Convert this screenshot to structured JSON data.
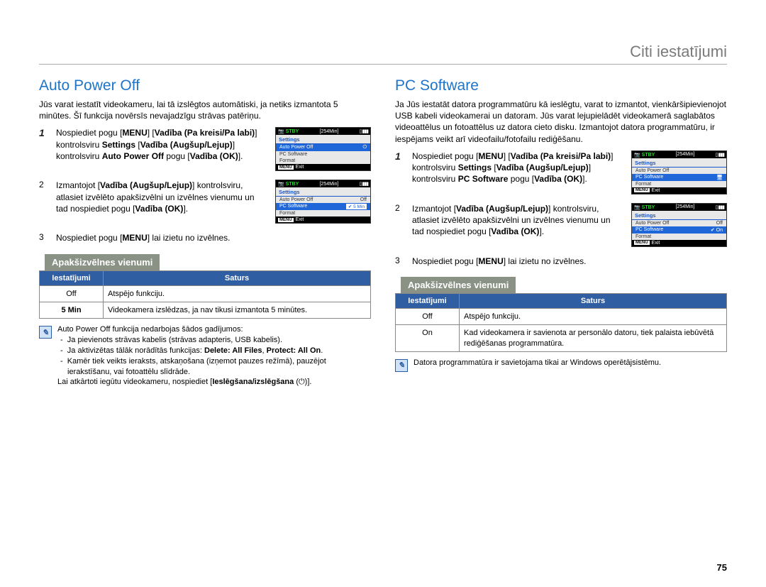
{
  "chapter_title": "Citi iestatījumi",
  "page_number": "75",
  "left": {
    "title": "Auto Power Off",
    "intro": "Jūs varat iestatīt videokameru, lai tā izslēgtos automātiski, ja netiks izmantota 5 minūtes. Šī funkcija novērsīs nevajadzīgu strāvas patēriņu.",
    "step1_a": "Nospiediet pogu [",
    "step1_b": "] ",
    "step1_c": " [",
    "step1_d": "Vadība (Pa kreisi/Pa labi)",
    "step1_e": "] kontrolsviru ",
    "step1_f": "Settings",
    "step1_g": " [",
    "step1_h": "Vadība (Augšup/Lejup)",
    "step1_i": "] kontrolsviru ",
    "step1_j": "Auto Power Off",
    "step1_k": "  pogu [",
    "step1_l": "Vadība (OK)",
    "step1_m": "].",
    "menu_label": "MENU",
    "step2_a": "Izmantojot [",
    "step2_b": "Vadība (Augšup/Lejup)",
    "step2_c": "] kontrolsviru, atlasiet izvēlēto apakšizvēlni un izvēlnes vienumu un tad nospiediet pogu [",
    "step2_d": "Vadība (OK)",
    "step2_e": "].",
    "step3_a": "Nospiediet pogu [",
    "step3_b": "] lai izietu no izvēlnes.",
    "sub_header": "Apakšizvēlnes vienumi",
    "table": {
      "head1": "Iestatījumi",
      "head2": "Saturs",
      "r1c1": "Off",
      "r1c2": "Atspējo funkciju.",
      "r2c1": "5 Min",
      "r2c2": "Videokamera izslēdzas, ja nav tikusi izmantota 5 minūtes."
    },
    "note_intro": "Auto Power Off funkcija nedarbojas šādos gadījumos:",
    "note_1": "Ja pievienots strāvas kabelis (strāvas adapteris, USB kabelis).",
    "note_2a": "Ja aktivizētas tālāk norādītās funkcijas: ",
    "note_2b": "Delete: All Files",
    "note_2c": ", ",
    "note_2d": "Protect: All On",
    "note_2e": ".",
    "note_3": "Kamēr tiek veikts ieraksts, atskaņošana (izņemot pauzes režīmā), pauzējot ierakstīšanu, vai fotoattēlu slīdrāde.",
    "note_end_a": "Lai atkārtoti iegūtu videokameru, nospiediet [",
    "note_end_b": "Ieslēgšana/izslēgšana",
    "note_end_c": " (⏻)].",
    "cam1": {
      "t1": "STBY",
      "t2": "254Min",
      "tab": "Settings",
      "i1": "Auto Power Off",
      "i2": "PC Software",
      "i3": "Format",
      "foot": "Exit"
    },
    "cam2": {
      "t1": "STBY",
      "t2": "254Min",
      "tab": "Settings",
      "i1": "Auto Power Off",
      "v1": "Off",
      "i2": "PC Software",
      "v2": "5 Min",
      "i3": "Format",
      "foot": "Exit"
    }
  },
  "right": {
    "title": "PC Software",
    "intro": "Ja Jūs iestatāt datora programmatūru kā ieslēgtu, varat to izmantot, vienkāršipievienojot USB kabeli videokamerai un datoram. Jūs varat lejupielādēt videokamerā saglabātos videoattēlus un fotoattēlus uz datora cieto disku. Izmantojot datora programmatūru, ir iespējams veikt arī videofailu/fotofailu rediģēšanu.",
    "step1_a": "Nospiediet pogu [",
    "step1_b": "] ",
    "step1_c": " [",
    "step1_d": "Vadība (Pa kreisi/Pa labi)",
    "step1_e": "] kontrolsviru ",
    "step1_f": "Settings",
    "step1_g": " [",
    "step1_h": "Vadība (Augšup/Lejup)",
    "step1_i": "] kontrolsviru ",
    "step1_j": "PC Software",
    "step1_k": "  pogu [",
    "step1_l": "Vadība (OK)",
    "step1_m": "].",
    "step2_a": "Izmantojot [",
    "step2_b": "Vadība (Augšup/Lejup)",
    "step2_c": "] kontrolsviru, atlasiet izvēlēto apakšizvēlni un izvēlnes vienumu un tad nospiediet pogu [",
    "step2_d": "Vadība (OK)",
    "step2_e": "].",
    "step3_a": "Nospiediet pogu [",
    "step3_b": "] lai izietu no izvēlnes.",
    "sub_header": "Apakšizvēlnes vienumi",
    "table": {
      "head1": "Iestatījumi",
      "head2": "Saturs",
      "r1c1": "Off",
      "r1c2": "Atspējo funkciju.",
      "r2c1": "On",
      "r2c2": "Kad videokamera ir savienota ar personālo datoru, tiek palaista iebūvētā rediģēšanas programmatūra."
    },
    "note": "Datora programmatūra ir savietojama tikai ar Windows operētājsistēmu.",
    "cam1": {
      "t1": "STBY",
      "t2": "254Min",
      "tab": "Settings",
      "i1": "Auto Power Off",
      "i2": "PC Software",
      "i3": "Format",
      "foot": "Exit"
    },
    "cam2": {
      "t1": "STBY",
      "t2": "254Min",
      "tab": "Settings",
      "i1": "Auto Power Off",
      "v1": "Off",
      "i2": "PC Software",
      "v2": "On",
      "i3": "Format",
      "foot": "Exit"
    }
  }
}
